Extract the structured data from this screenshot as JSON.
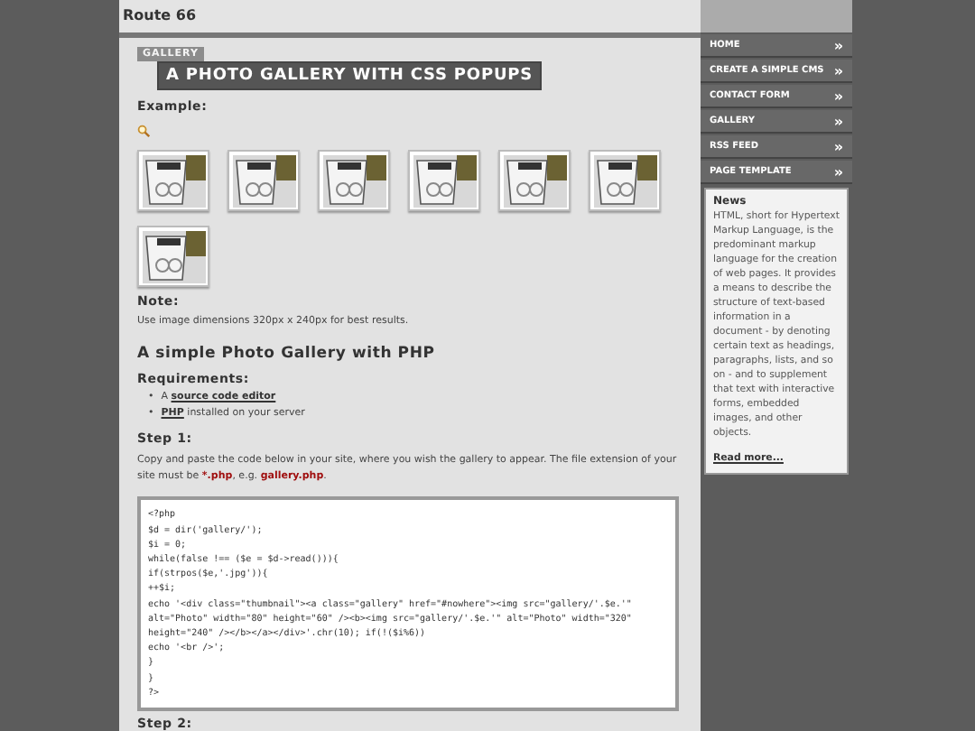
{
  "header": {
    "title": "Route 66"
  },
  "article": {
    "category": "GALLERY",
    "title": "A PHOTO GALLERY WITH CSS POPUPS",
    "example_heading": "Example:",
    "thumbnails": [
      {
        "kind": "photo"
      },
      {
        "kind": "photo"
      },
      {
        "kind": "photo"
      },
      {
        "kind": "photo"
      },
      {
        "kind": "photo"
      },
      {
        "kind": "photo"
      },
      {
        "kind": "photo"
      }
    ],
    "note_heading": "Note:",
    "note_text": "Use image dimensions 320px x 240px for best results.",
    "section_heading": "A simple Photo Gallery with PHP",
    "requirements_heading": "Requirements:",
    "requirements": [
      {
        "bullet": "•",
        "parts": [
          {
            "kind": "plain",
            "text": "A "
          },
          {
            "kind": "link",
            "text": "source code editor"
          }
        ]
      },
      {
        "bullet": "•",
        "parts": [
          {
            "kind": "link",
            "text": "PHP"
          },
          {
            "kind": "plain",
            "text": " installed on your server"
          }
        ]
      }
    ],
    "step1_heading": "Step 1:",
    "step1_text": [
      {
        "kind": "plain",
        "text": "Copy and paste the code below in your site, where you wish the gallery to appear. The file extension of your site must be "
      },
      {
        "kind": "code",
        "text": "*.php"
      },
      {
        "kind": "plain",
        "text": ", e.g. "
      },
      {
        "kind": "code",
        "text": "gallery.php"
      },
      {
        "kind": "plain",
        "text": "."
      }
    ],
    "code": [
      "<?php",
      "$d = dir('gallery/');",
      "$i = 0;",
      "while(false !== ($e = $d->read())){",
      "if(strpos($e,'.jpg')){",
      "++$i;",
      "echo '<div class=\"thumbnail\"><a class=\"gallery\" href=\"#nowhere\"><img src=\"gallery/'.$e.'\"",
      "alt=\"Photo\" width=\"80\" height=\"60\" /><b><img src=\"gallery/'.$e.'\" alt=\"Photo\" width=\"320\"",
      "height=\"240\" /></b></a></div>'.chr(10); if(!($i%6))",
      "echo '<br />';",
      "}",
      "}",
      "?>"
    ],
    "step2_heading": "Step 2:"
  },
  "nav": {
    "items": [
      {
        "label": "HOME",
        "arrow": "»"
      },
      {
        "label": "CREATE A SIMPLE CMS",
        "arrow": "»"
      },
      {
        "label": "CONTACT FORM",
        "arrow": "»"
      },
      {
        "label": "GALLERY",
        "arrow": "»"
      },
      {
        "label": "RSS FEED",
        "arrow": "»"
      },
      {
        "label": "PAGE TEMPLATE",
        "arrow": "»"
      }
    ]
  },
  "news": {
    "title": "News",
    "text": "HTML, short for Hypertext Markup Language, is the predominant markup language for the creation of web pages. It provides a means to describe the structure of text-based information in a document - by denoting certain text as headings, paragraphs, lists, and so on - and to supplement that text with interactive forms, embedded images, and other objects.",
    "link": "Read more..."
  }
}
